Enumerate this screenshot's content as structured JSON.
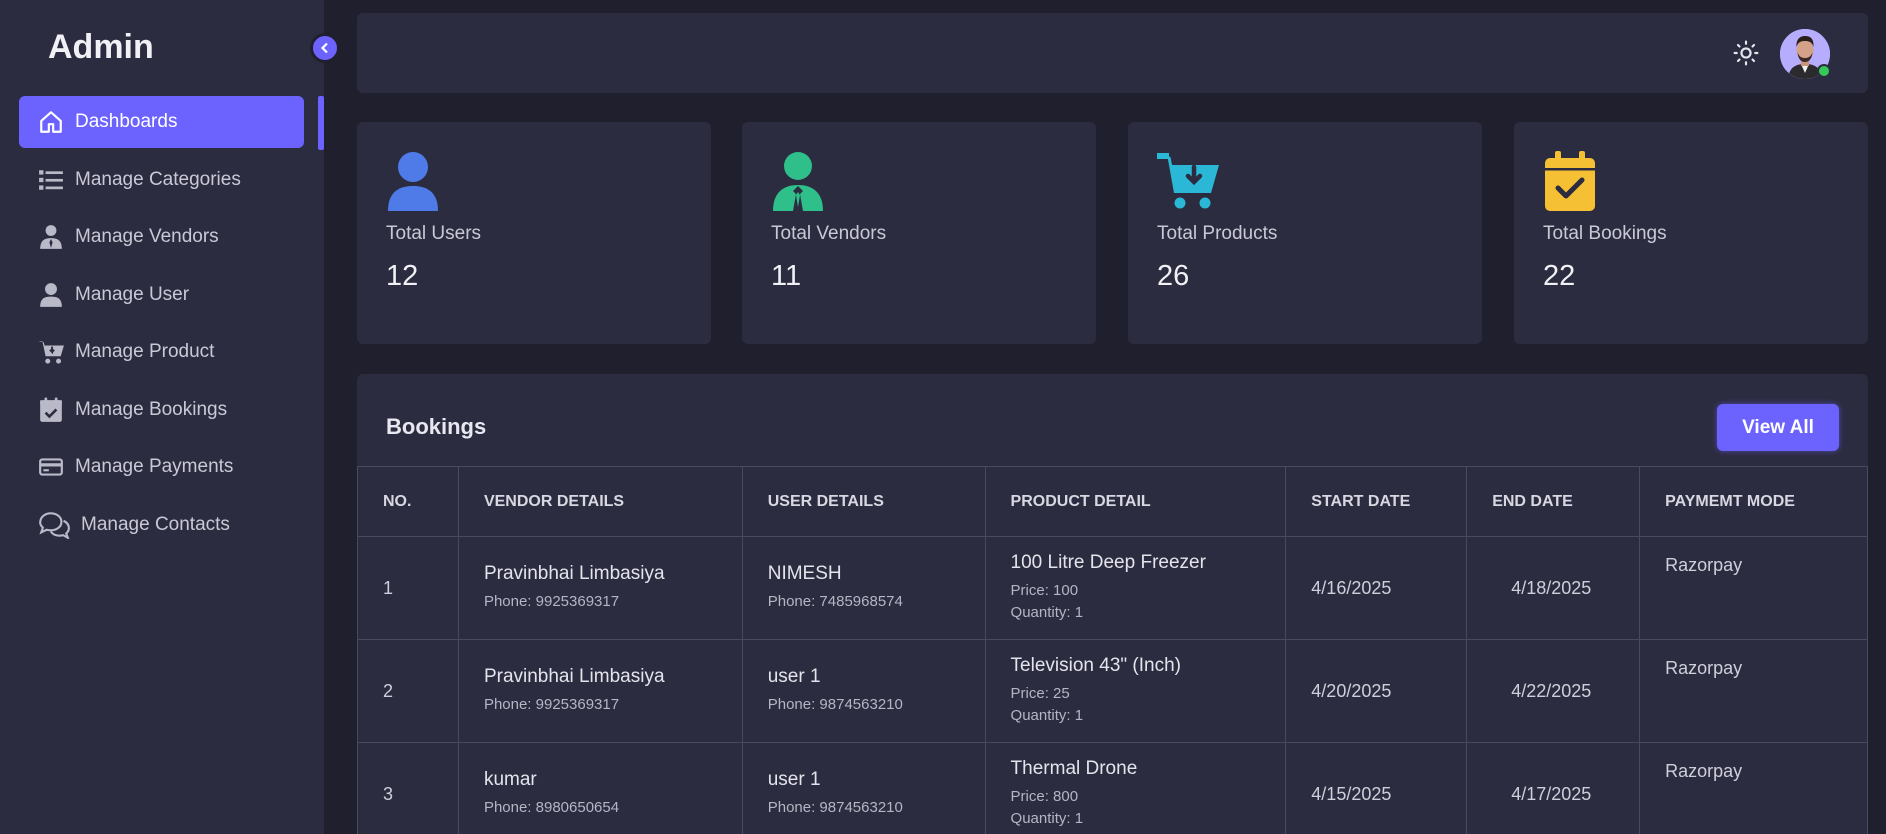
{
  "sidebar": {
    "brand": "Admin",
    "items": [
      {
        "label": "Dashboards",
        "icon": "home-icon",
        "active": true
      },
      {
        "label": "Manage Categories",
        "icon": "list-icon"
      },
      {
        "label": "Manage Vendors",
        "icon": "vendor-icon"
      },
      {
        "label": "Manage User",
        "icon": "user-icon"
      },
      {
        "label": "Manage Product",
        "icon": "cart-icon"
      },
      {
        "label": "Manage Bookings",
        "icon": "calendar-check-icon"
      },
      {
        "label": "Manage Payments",
        "icon": "credit-card-icon"
      },
      {
        "label": "Manage Contacts",
        "icon": "chat-icon"
      }
    ]
  },
  "header": {
    "theme_icon": "sun-icon",
    "avatar_status": "online"
  },
  "stats": [
    {
      "label": "Total Users",
      "value": "12",
      "icon": "user-icon",
      "color": "#4f7be8"
    },
    {
      "label": "Total Vendors",
      "value": "11",
      "icon": "vendor-icon",
      "color": "#2fbf8a"
    },
    {
      "label": "Total Products",
      "value": "26",
      "icon": "cart-download-icon",
      "color": "#2bb8d6"
    },
    {
      "label": "Total Bookings",
      "value": "22",
      "icon": "calendar-check-icon",
      "color": "#f5c033"
    }
  ],
  "bookings": {
    "title": "Bookings",
    "view_all": "View All",
    "columns": [
      "NO.",
      "VENDOR DETAILS",
      "USER DETAILS",
      "PRODUCT DETAIL",
      "START DATE",
      "END DATE",
      "PAYMEMT MODE"
    ],
    "rows": [
      {
        "no": "1",
        "vendor_name": "Pravinbhai Limbasiya",
        "vendor_phone": "Phone: 9925369317",
        "user_name": "NIMESH",
        "user_phone": "Phone: 7485968574",
        "product": "100 Litre Deep Freezer",
        "price": "Price: 100",
        "qty": "Quantity: 1",
        "start": "4/16/2025",
        "end": "4/18/2025",
        "payment": "Razorpay"
      },
      {
        "no": "2",
        "vendor_name": "Pravinbhai Limbasiya",
        "vendor_phone": "Phone: 9925369317",
        "user_name": "user 1",
        "user_phone": "Phone: 9874563210",
        "product": "Television 43\" (Inch)",
        "price": "Price: 25",
        "qty": "Quantity: 1",
        "start": "4/20/2025",
        "end": "4/22/2025",
        "payment": "Razorpay"
      },
      {
        "no": "3",
        "vendor_name": "kumar",
        "vendor_phone": "Phone: 8980650654",
        "user_name": "user 1",
        "user_phone": "Phone: 9874563210",
        "product": "Thermal Drone",
        "price": "Price: 800",
        "qty": "Quantity: 1",
        "start": "4/15/2025",
        "end": "4/17/2025",
        "payment": "Razorpay"
      }
    ]
  },
  "colors": {
    "accent": "#6c63ff",
    "background": "#1f1f2d",
    "panel": "#2c2c40",
    "online": "#35c75a"
  }
}
